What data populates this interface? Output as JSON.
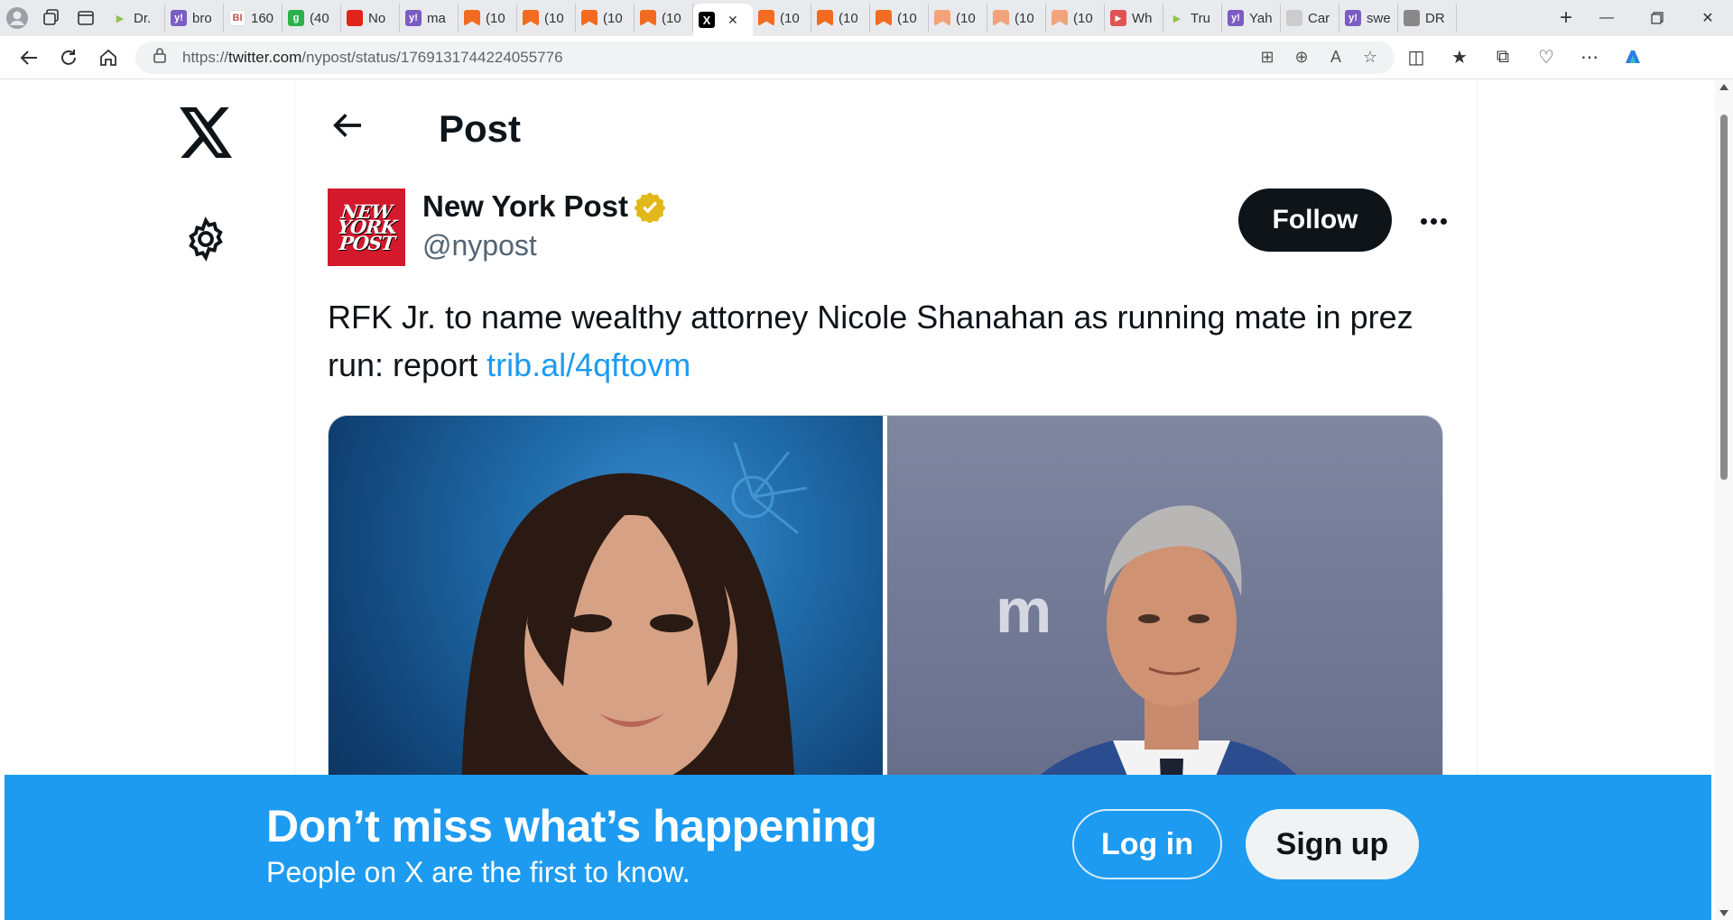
{
  "browser": {
    "tabs": [
      {
        "label": "Dr.",
        "favicon": "play-icon",
        "color": "#8bc34a"
      },
      {
        "label": "bro",
        "favicon": "yahoo-icon",
        "color": "#7b5cc4"
      },
      {
        "label": "160",
        "favicon": "bi-icon",
        "color": "#ffffff"
      },
      {
        "label": "(40",
        "favicon": "g-icon",
        "color": "#2bb24c"
      },
      {
        "label": "No",
        "favicon": "news-icon",
        "color": "#e0241b"
      },
      {
        "label": "ma",
        "favicon": "yahoo-icon",
        "color": "#7b5cc4"
      },
      {
        "label": "(10",
        "favicon": "bookmark-icon",
        "color": "#f26b21"
      },
      {
        "label": "(10",
        "favicon": "bookmark-icon",
        "color": "#f26b21"
      },
      {
        "label": "(10",
        "favicon": "bookmark-icon",
        "color": "#f26b21"
      },
      {
        "label": "(10",
        "favicon": "bookmark-icon",
        "color": "#f26b21"
      },
      {
        "label": "",
        "favicon": "x-icon",
        "color": "#000000",
        "active": true
      },
      {
        "label": "(10",
        "favicon": "bookmark-icon",
        "color": "#f26b21"
      },
      {
        "label": "(10",
        "favicon": "bookmark-icon",
        "color": "#f26b21"
      },
      {
        "label": "(10",
        "favicon": "bookmark-icon",
        "color": "#f26b21"
      },
      {
        "label": "(10",
        "favicon": "bookmark-icon",
        "color": "#f2a37a"
      },
      {
        "label": "(10",
        "favicon": "bookmark-icon",
        "color": "#f2a37a"
      },
      {
        "label": "(10",
        "favicon": "bookmark-icon",
        "color": "#f2a37a"
      },
      {
        "label": "Wh",
        "favicon": "youtube-icon",
        "color": "#e05353"
      },
      {
        "label": "Tru",
        "favicon": "play-icon",
        "color": "#8bc34a"
      },
      {
        "label": "Yah",
        "favicon": "yahoo-icon",
        "color": "#7b5cc4"
      },
      {
        "label": "Car",
        "favicon": "site-icon",
        "color": "#cccccc"
      },
      {
        "label": "swe",
        "favicon": "yahoo-icon",
        "color": "#7b5cc4"
      },
      {
        "label": "DR",
        "favicon": "site-icon",
        "color": "#888888"
      }
    ],
    "url_prefix": "https://",
    "url_host": "twitter.com",
    "url_path": "/nypost/status/1769131744224055776"
  },
  "post": {
    "page_title": "Post",
    "author_name": "New York Post",
    "author_handle": "@nypost",
    "avatar_lines": [
      "NEW",
      "YORK",
      "POST"
    ],
    "follow_label": "Follow",
    "text": "RFK Jr. to name wealthy attorney Nicole Shanahan as running mate in prez run: report ",
    "link": "trib.al/4qftovm",
    "verified_color": "#e2b719"
  },
  "banner": {
    "title": "Don’t miss what’s happening",
    "subtitle": "People on X are the first to know.",
    "login_label": "Log in",
    "signup_label": "Sign up",
    "background": "#1d9bf0"
  }
}
